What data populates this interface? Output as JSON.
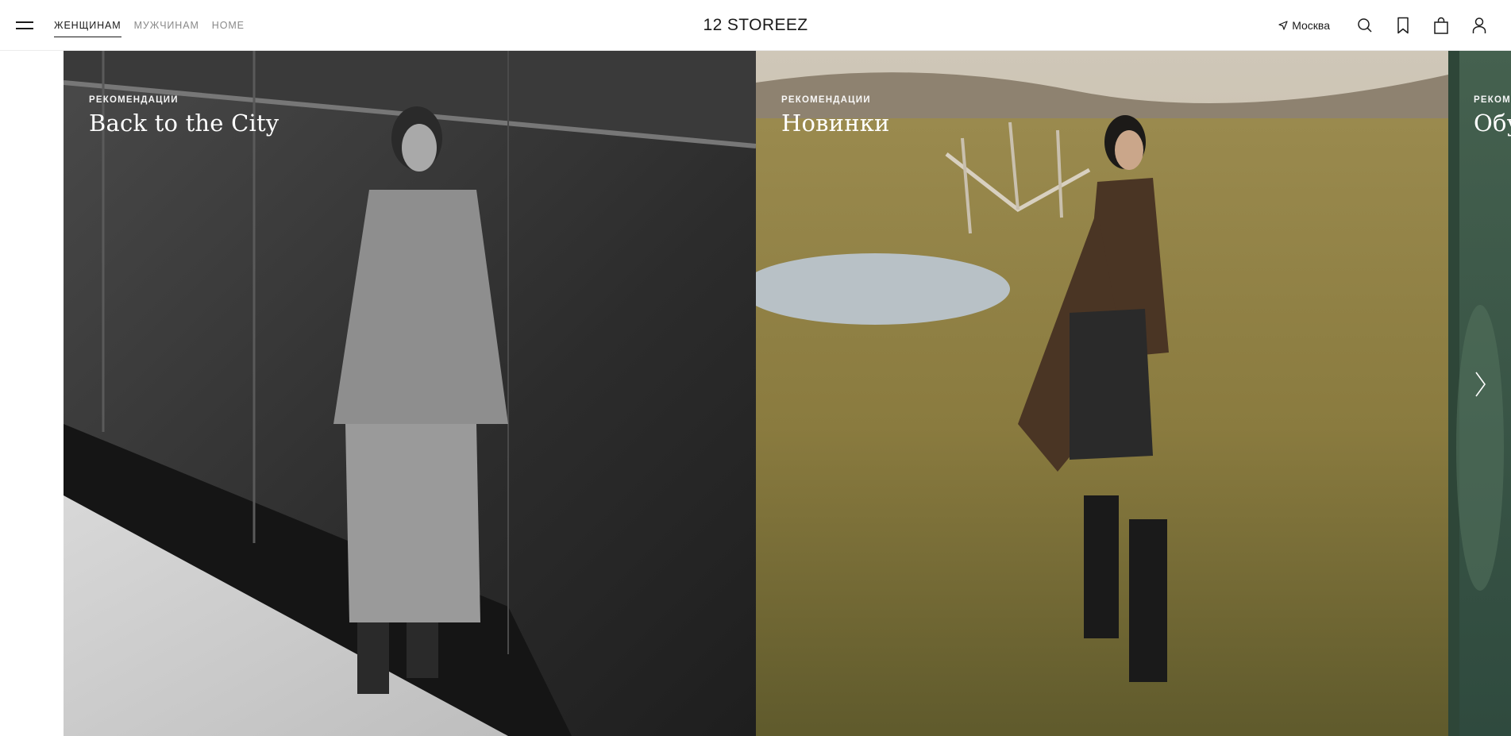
{
  "header": {
    "menu_icon": "burger-menu-icon",
    "nav": [
      {
        "label": "ЖЕНЩИНАМ",
        "active": true
      },
      {
        "label": "МУЖЧИНАМ",
        "active": false
      },
      {
        "label": "HOME",
        "active": false
      }
    ],
    "logo": "12 STOREEZ",
    "city": "Москва",
    "icons": [
      "location-arrow-icon",
      "search-icon",
      "bookmark-icon",
      "bag-icon",
      "user-icon"
    ]
  },
  "slides": [
    {
      "kicker": "РЕКОМЕНДАЦИИ",
      "title": "Back to the City"
    },
    {
      "kicker": "РЕКОМЕНДАЦИИ",
      "title": "Новинки"
    },
    {
      "kicker": "РЕКОМЕНДАЦИИ",
      "title": "Обувь"
    }
  ],
  "carousel": {
    "next_icon": "chevron-right-icon"
  },
  "colors": {
    "text": "#1a1a1a",
    "muted_nav": "#8a8a8a",
    "slide1_bg": "#3b3b3b",
    "slide2_bg": "#8a7a4a",
    "slide3_bg": "#3f5a4e"
  }
}
